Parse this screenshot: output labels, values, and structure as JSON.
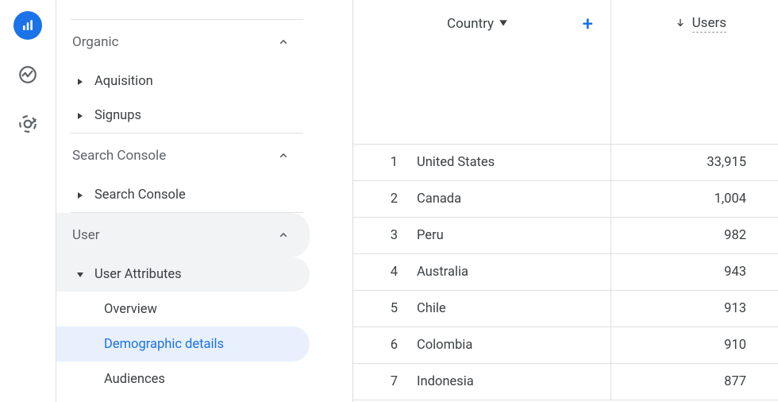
{
  "rail_icons": [
    "bar-chart",
    "realtime",
    "explore"
  ],
  "sidebar": {
    "organic": {
      "label": "Organic"
    },
    "acquisition": {
      "label": "Aquisition"
    },
    "signups": {
      "label": "Signups"
    },
    "search_console_group": {
      "label": "Search Console"
    },
    "search_console_item": {
      "label": "Search Console"
    },
    "user_group": {
      "label": "User"
    },
    "user_attributes": {
      "label": "User Attributes"
    },
    "overview": {
      "label": "Overview"
    },
    "demographic": {
      "label": "Demographic details"
    },
    "audiences": {
      "label": "Audiences"
    }
  },
  "table": {
    "dimension_label": "Country",
    "metric_label": "Users",
    "rows": [
      {
        "idx": "1",
        "name": "United States",
        "users": "33,915"
      },
      {
        "idx": "2",
        "name": "Canada",
        "users": "1,004"
      },
      {
        "idx": "3",
        "name": "Peru",
        "users": "982"
      },
      {
        "idx": "4",
        "name": "Australia",
        "users": "943"
      },
      {
        "idx": "5",
        "name": "Chile",
        "users": "913"
      },
      {
        "idx": "6",
        "name": "Colombia",
        "users": "910"
      },
      {
        "idx": "7",
        "name": "Indonesia",
        "users": "877"
      }
    ]
  }
}
